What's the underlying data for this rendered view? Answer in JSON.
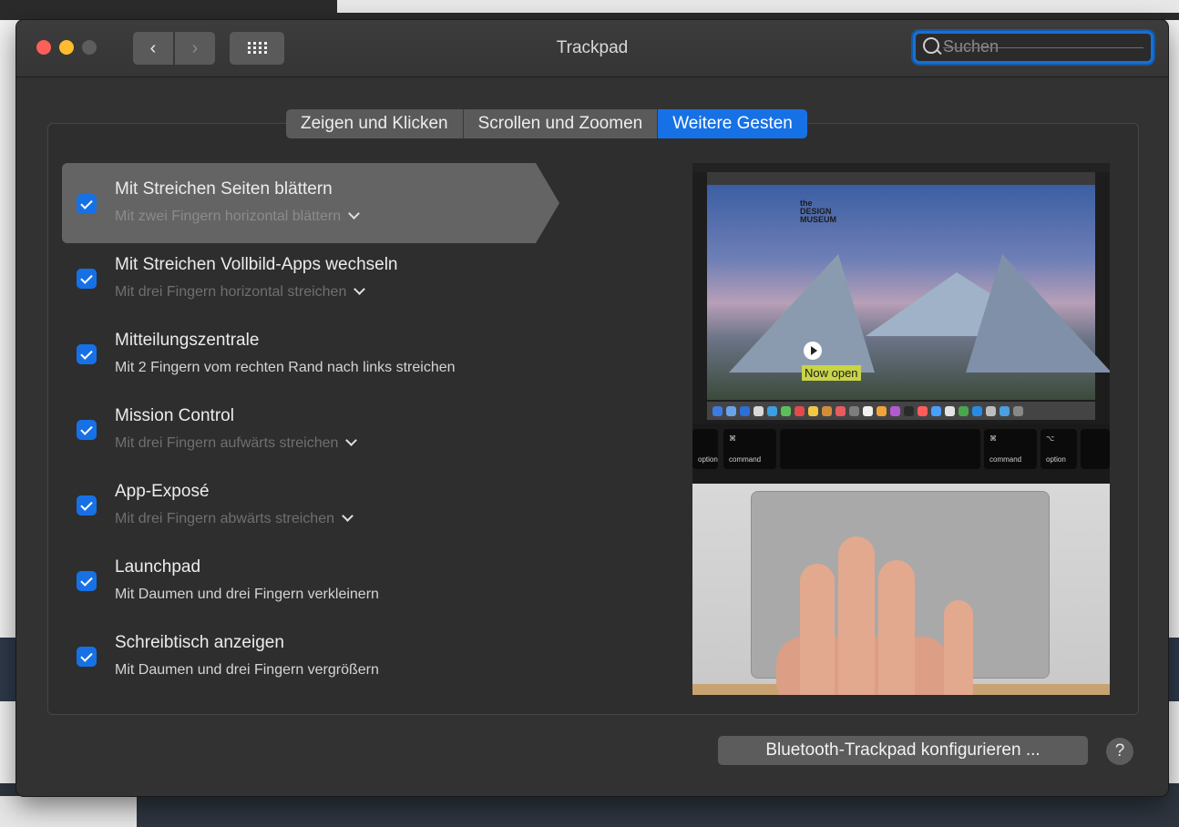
{
  "window": {
    "title": "Trackpad",
    "search_placeholder": "Suchen"
  },
  "tabs": [
    {
      "label": "Zeigen und Klicken",
      "active": false
    },
    {
      "label": "Scrollen und Zoomen",
      "active": false
    },
    {
      "label": "Weitere Gesten",
      "active": true
    }
  ],
  "gestures": [
    {
      "title": "Mit Streichen Seiten blättern",
      "subtitle": "Mit zwei Fingern horizontal blättern",
      "checked": true,
      "selected": true,
      "has_dropdown": true
    },
    {
      "title": "Mit Streichen Vollbild-Apps wechseln",
      "subtitle": "Mit drei Fingern horizontal streichen",
      "checked": true,
      "selected": false,
      "has_dropdown": true
    },
    {
      "title": "Mitteilungszentrale",
      "subtitle": "Mit 2 Fingern vom rechten Rand nach links streichen",
      "checked": true,
      "selected": false,
      "has_dropdown": false
    },
    {
      "title": "Mission Control",
      "subtitle": "Mit drei Fingern aufwärts streichen",
      "checked": true,
      "selected": false,
      "has_dropdown": true
    },
    {
      "title": "App-Exposé",
      "subtitle": "Mit drei Fingern abwärts streichen",
      "checked": true,
      "selected": false,
      "has_dropdown": true
    },
    {
      "title": "Launchpad",
      "subtitle": "Mit Daumen und drei Fingern verkleinern",
      "checked": true,
      "selected": false,
      "has_dropdown": false
    },
    {
      "title": "Schreibtisch anzeigen",
      "subtitle": "Mit Daumen und drei Fingern vergrößern",
      "checked": true,
      "selected": false,
      "has_dropdown": false
    }
  ],
  "preview": {
    "logo_lines": [
      "the",
      "DESIGN",
      "MUSEUM"
    ],
    "banner": "Now open",
    "keys": {
      "left_option": "option",
      "left_command": "command",
      "right_command": "command",
      "right_option": "option",
      "command_symbol": "⌘",
      "option_symbol": "⌥"
    }
  },
  "footer": {
    "bluetooth_button": "Bluetooth-Trackpad konfigurieren ...",
    "help": "?"
  },
  "colors": {
    "accent": "#1771e6",
    "window_bg": "#323232"
  }
}
